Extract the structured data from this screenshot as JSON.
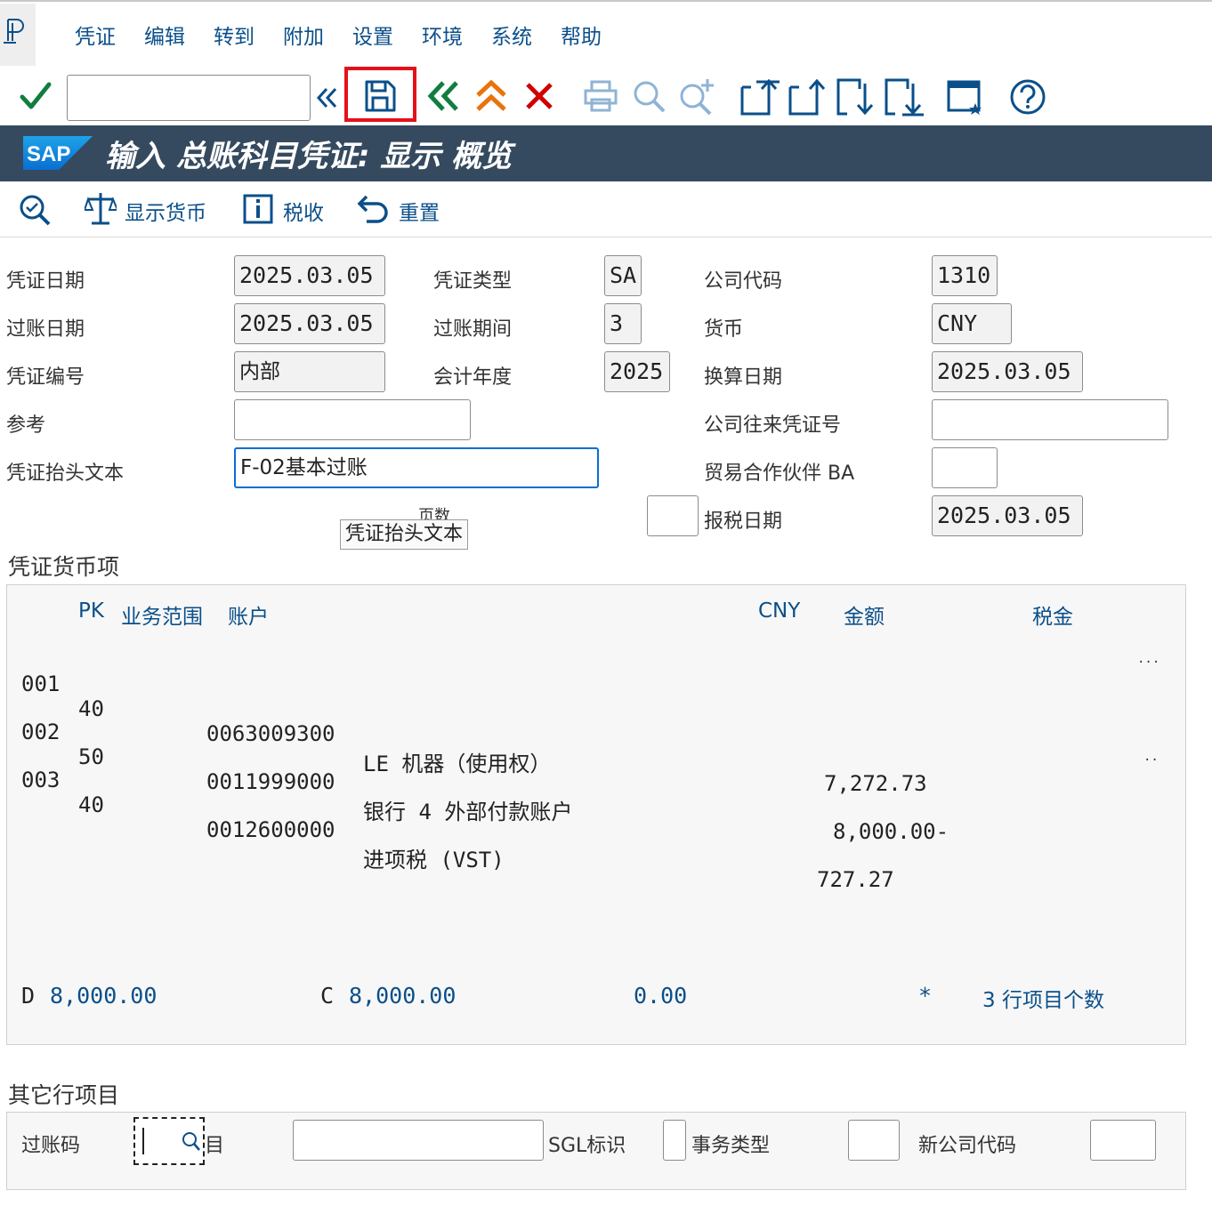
{
  "menu": [
    "凭证",
    "编辑",
    "转到",
    "附加",
    "设置",
    "环境",
    "系统",
    "帮助"
  ],
  "toolbar": {
    "command_value": "",
    "icons": [
      "check-icon",
      "collapse-icon",
      "save-icon",
      "back-icon",
      "exit-icon",
      "cancel-icon",
      "print-icon",
      "find-icon",
      "find-next-icon",
      "first-page-icon",
      "previous-page-icon",
      "next-page-icon",
      "last-page-icon",
      "layout-icon",
      "help-icon"
    ],
    "highlight_color": "#e4101a"
  },
  "title": {
    "logo_text": "SAP",
    "text": "输入 总账科目凭证: 显示 概览"
  },
  "app_toolbar": {
    "display_currency": "显示货币",
    "tax": "税收",
    "reset": "重置"
  },
  "header": {
    "doc_date_label": "凭证日期",
    "doc_date": "2025.03.05",
    "doc_type_label": "凭证类型",
    "doc_type": "SA",
    "company_code_label": "公司代码",
    "company_code": "1310",
    "posting_date_label": "过账日期",
    "posting_date": "2025.03.05",
    "period_label": "过账期间",
    "period": "3",
    "currency_label": "货币",
    "currency": "CNY",
    "doc_number_label": "凭证编号",
    "doc_number": "内部",
    "fiscal_year_label": "会计年度",
    "fiscal_year": "2025",
    "translation_date_label": "换算日期",
    "translation_date": "2025.03.05",
    "reference_label": "参考",
    "reference": "",
    "intercompany_label": "公司往来凭证号",
    "intercompany": "",
    "header_text_label": "凭证抬头文本",
    "header_text": "F-02基本过账",
    "partner_ba_label": "贸易合作伙伴 BA",
    "partner_ba": "",
    "page_count_label": "页数",
    "tooltip": "凭证抬头文本",
    "tax_report_date_label": "报税日期",
    "tax_report_date": "2025.03.05"
  },
  "items": {
    "section_title": "凭证货币项",
    "col_pk": "PK",
    "col_ba": "业务范围",
    "col_account": "账户",
    "col_currency": "CNY",
    "col_amount": "金额",
    "col_tax": "税金",
    "rows": [
      {
        "no": "001",
        "pk": "40",
        "account": "0063009300",
        "text": "LE 机器（使用权）",
        "amount": "7,272.73",
        "extra": "..."
      },
      {
        "no": "002",
        "pk": "50",
        "account": "0011999000",
        "text": "银行 4 外部付款账户",
        "amount": "8,000.00-",
        "extra": ""
      },
      {
        "no": "003",
        "pk": "40",
        "account": "0012600000",
        "text": "进项税 (VST)",
        "amount": "727.27",
        "extra": ".."
      }
    ],
    "totals": {
      "debit_label": "D",
      "debit": "8,000.00",
      "credit_label": "C",
      "credit": "8,000.00",
      "balance": "0.00",
      "star": "*",
      "line_count_text": "3 行项目个数"
    }
  },
  "other": {
    "section_title": "其它行项目",
    "posting_key_label": "过账码",
    "posting_key": "",
    "account_label_fragment": "目",
    "account": "",
    "sgl_label": "SGL标识",
    "sgl": "",
    "trans_type_label": "事务类型",
    "trans_type": "",
    "new_company_label": "新公司代码",
    "new_company": ""
  }
}
